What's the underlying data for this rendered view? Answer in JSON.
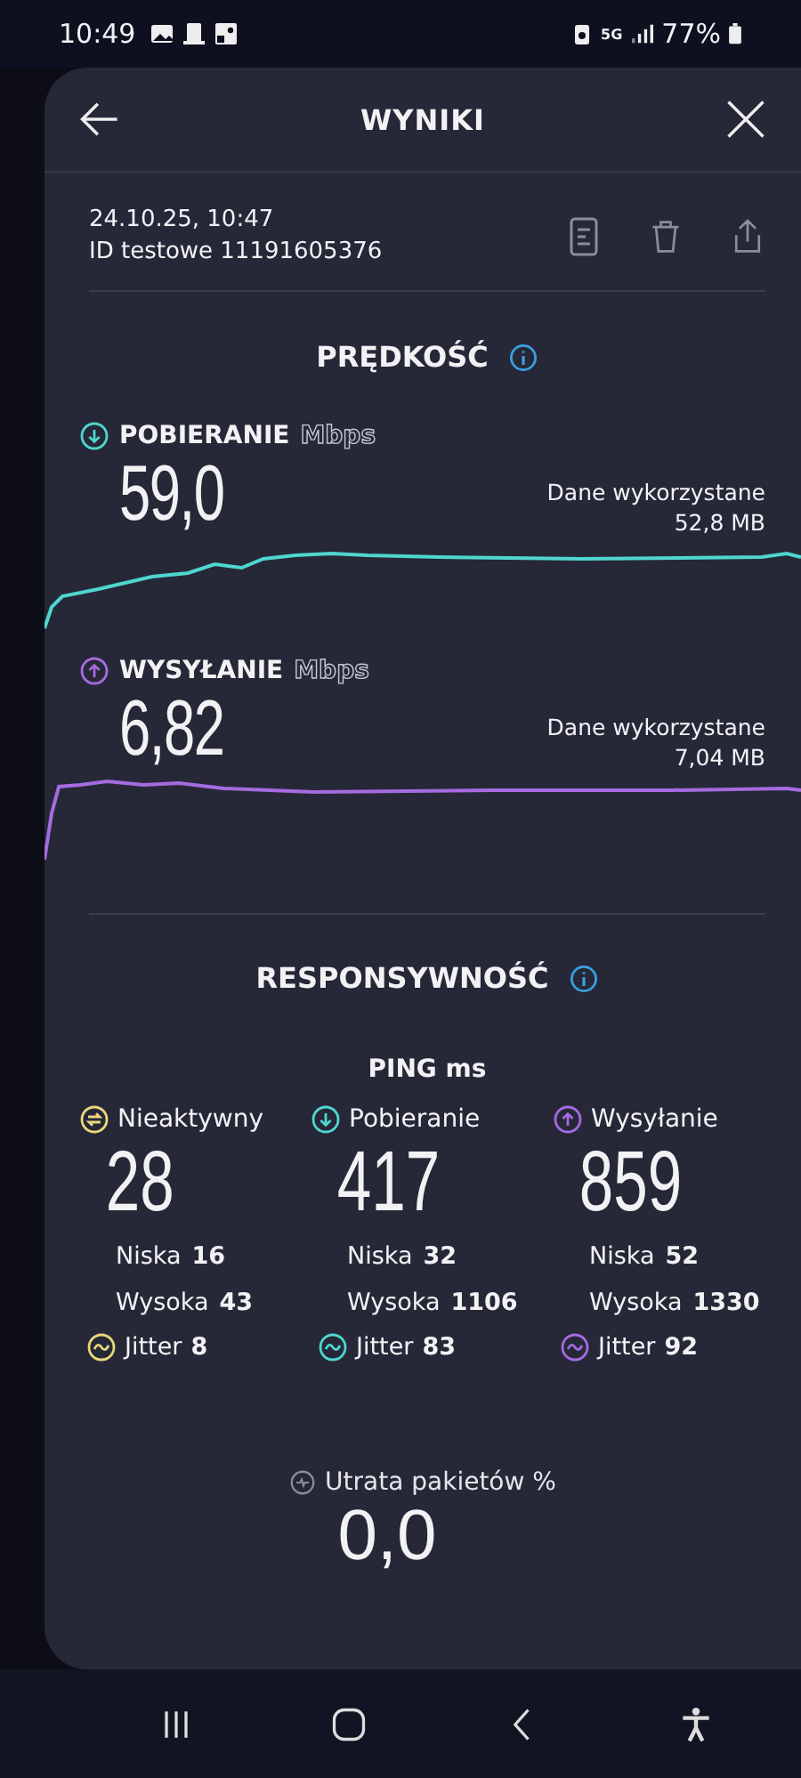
{
  "status_bar": {
    "time": "10:49",
    "network": "5G",
    "battery": "77%"
  },
  "header": {
    "title": "WYNIKI"
  },
  "test": {
    "date": "24.10.25, 10:47",
    "id": "ID testowe 11191605376"
  },
  "speed": {
    "title": "PRĘDKOŚĆ",
    "measurements": [
      {
        "kind": "download",
        "label": "POBIERANIE",
        "unit": "Mbps",
        "value": "59,0",
        "data_label": "Dane wykorzystane",
        "data_value": "52,8 MB",
        "color": "#4fd6d0"
      },
      {
        "kind": "upload",
        "label": "WYSYŁANIE",
        "unit": "Mbps",
        "value": "6,82",
        "data_label": "Dane wykorzystane",
        "data_value": "7,04 MB",
        "color": "#a66be0"
      }
    ]
  },
  "responsiveness": {
    "title": "RESPONSYWNOŚĆ",
    "ping_title": "PING ms",
    "columns": [
      {
        "kind": "idle",
        "label": "Nieaktywny",
        "value": "28",
        "low_label": "Niska",
        "low": "16",
        "high_label": "Wysoka",
        "high": "43",
        "jitter_label": "Jitter",
        "jitter": "8",
        "color": "#e8d87a"
      },
      {
        "kind": "download",
        "label": "Pobieranie",
        "value": "417",
        "low_label": "Niska",
        "low": "32",
        "high_label": "Wysoka",
        "high": "1106",
        "jitter_label": "Jitter",
        "jitter": "83",
        "color": "#4fd6d0"
      },
      {
        "kind": "upload",
        "label": "Wysyłanie",
        "value": "859",
        "low_label": "Niska",
        "low": "52",
        "high_label": "Wysoka",
        "high": "1330",
        "jitter_label": "Jitter",
        "jitter": "92",
        "color": "#a66be0"
      }
    ]
  },
  "packet_loss": {
    "label": "Utrata pakietów %",
    "value": "0,0"
  }
}
